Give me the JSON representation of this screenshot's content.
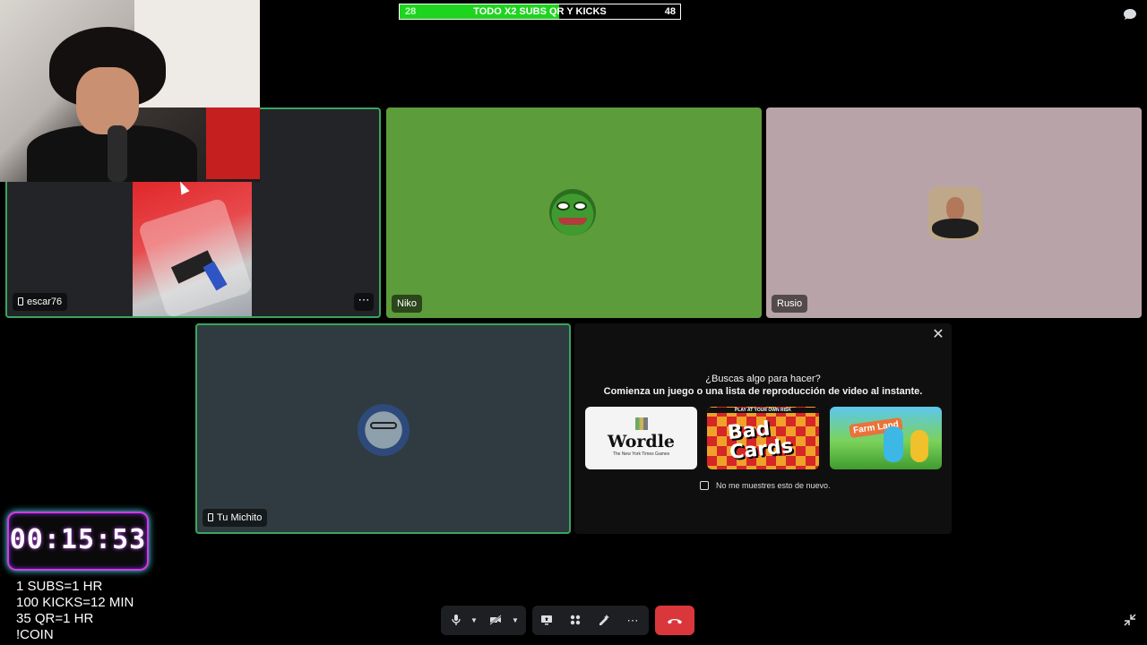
{
  "goal_bar": {
    "label": "TODO X2 SUBS QR Y KICKS",
    "start": "28",
    "end": "48",
    "progress": 0.57,
    "fill_color": "#1fd41f"
  },
  "participants": [
    {
      "name": "escar76",
      "device": "mobile",
      "speaking": true
    },
    {
      "name": "Niko",
      "device": "desktop",
      "speaking": false
    },
    {
      "name": "Rusio",
      "device": "desktop",
      "speaking": false
    },
    {
      "name": "Tu Michito",
      "device": "mobile",
      "speaking": true
    }
  ],
  "activity_panel": {
    "title": "¿Buscas algo para hacer?",
    "subtitle": "Comienza un juego o una lista de reproducción de video al instante.",
    "games": [
      {
        "name": "Wordle",
        "publisher": "The New York Times Games"
      },
      {
        "name": "Bad Cards",
        "tagline": "PLAY AT YOUR OWN RISK"
      },
      {
        "name": "Farm Land"
      }
    ],
    "dont_show_again": "No me muestres esto de nuevo."
  },
  "timer": {
    "value": "00:15:53"
  },
  "rules": [
    "1 SUBS=1 HR",
    "100 KICKS=12 MIN",
    "35 QR=1 HR",
    "!COIN"
  ],
  "controls": {
    "mic_icon": "microphone-icon",
    "camera_icon": "camera-off-icon",
    "screen_icon": "screen-share-icon",
    "activities_icon": "activities-icon",
    "soundboard_icon": "soundboard-icon",
    "more_icon": "more-icon",
    "hangup_icon": "phone-hangup-icon"
  },
  "colors": {
    "speaking_border": "#3aa55d",
    "hangup": "#da373c",
    "niko_bg": "#5d9c3a",
    "rusio_bg": "#b8a4a8",
    "michito_bg": "#2f3b40"
  }
}
